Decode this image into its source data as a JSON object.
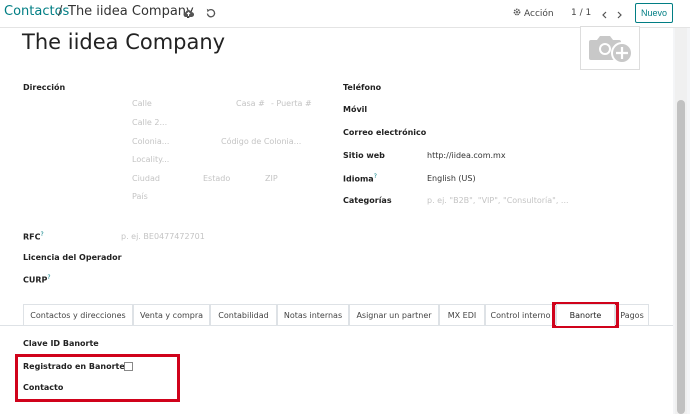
{
  "breadcrumb": {
    "root": "Contactos",
    "separator": "/",
    "current": "The iidea Company"
  },
  "toolbar": {
    "action_label": "Acción",
    "pager_value": "1 / 1",
    "new_label": "Nuevo"
  },
  "partner": {
    "name": "The iidea Company"
  },
  "address": {
    "label": "Dirección",
    "street_ph": "Calle",
    "ext_ph": "Casa #",
    "int_ph": "- Puerta #",
    "street2_ph": "Calle 2...",
    "colony_ph": "Colonia...",
    "colony_code_ph": "Código de Colonia...",
    "locality_ph": "Locality...",
    "city_ph": "Ciudad",
    "state_ph": "Estado",
    "zip_ph": "ZIP",
    "country_ph": "País"
  },
  "contact": {
    "phone_label": "Teléfono",
    "mobile_label": "Móvil",
    "email_label": "Correo electrónico",
    "website_label": "Sitio web",
    "website_value": "http://iidea.com.mx",
    "language_label": "Idioma",
    "language_value": "English (US)",
    "categories_label": "Categorías",
    "categories_ph": "p. ej. \"B2B\", \"VIP\", \"Consultoría\", ..."
  },
  "fiscal": {
    "rfc_label": "RFC",
    "rfc_ph": "p. ej. BE0477472701",
    "license_label": "Licencia del Operador",
    "curp_label": "CURP",
    "help_mark": "?"
  },
  "tabs": [
    {
      "label": "Contactos y direcciones"
    },
    {
      "label": "Venta y compra"
    },
    {
      "label": "Contabilidad"
    },
    {
      "label": "Notas internas"
    },
    {
      "label": "Asignar un partner"
    },
    {
      "label": "MX EDI"
    },
    {
      "label": "Control interno"
    },
    {
      "label": "Banorte"
    },
    {
      "label": "Pagos"
    }
  ],
  "banorte": {
    "client_id_label": "Clave ID Banorte",
    "registered_label": "Registrado en Banorte",
    "contact_label": "Contacto"
  },
  "colors": {
    "accent": "#017e84",
    "highlight": "#d0021b"
  }
}
